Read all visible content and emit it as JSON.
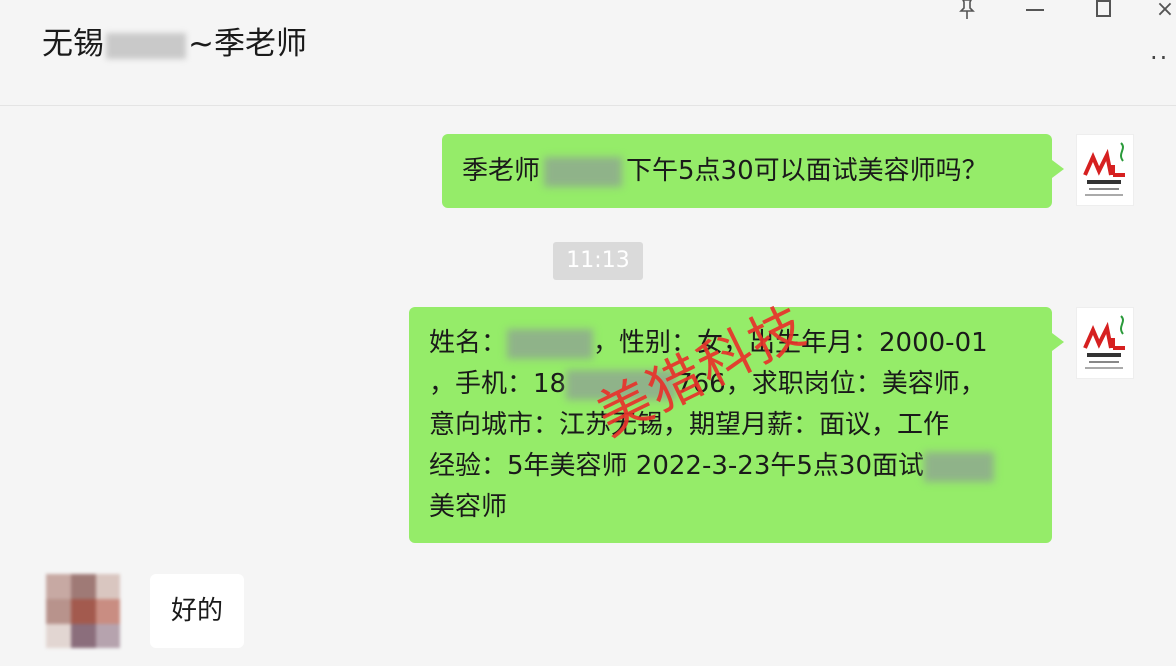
{
  "header": {
    "title_prefix": "无锡",
    "title_suffix": "~季老师"
  },
  "window_controls": {
    "pin_icon": "pin-icon",
    "minimize_icon": "minimize-icon",
    "maximize_icon": "maximize-icon",
    "close_icon": "close-icon",
    "more_icon": "more-icon"
  },
  "messages": {
    "msg1": {
      "prefix": "季老师",
      "suffix": "下午5点30可以面试美容师吗？"
    },
    "timestamp": "11:13",
    "msg2": {
      "line1_a": "姓名：",
      "line1_b": "，性别：女，出生年月：2000-01",
      "line2_a": "，手机：18",
      "line2_b": "766，求职岗位：美容师，",
      "line3": "意向城市：江苏无锡，期望月薪：面议，工作",
      "line4_a": "经验：5年美容师 2022-3-23午5点30面试",
      "line5": "美容师"
    },
    "reply": "好的"
  },
  "watermark": "美猎科技",
  "colors": {
    "bubble_self": "#95ec69",
    "bubble_peer": "#ffffff",
    "background": "#f5f5f5",
    "watermark": "#e8322b",
    "timestamp_bg": "#dadada"
  }
}
